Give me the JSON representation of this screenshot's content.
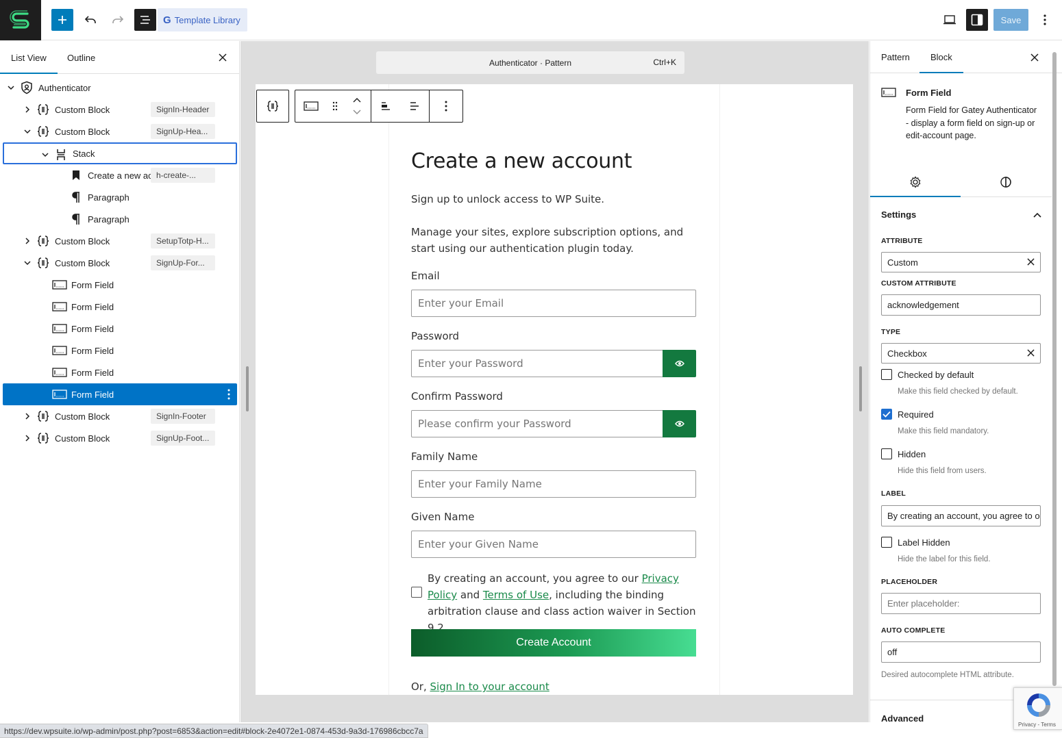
{
  "topbar": {
    "template_library_label": "Template Library",
    "save_label": "Save"
  },
  "left_panel": {
    "tabs": [
      "List View",
      "Outline"
    ],
    "tree": [
      {
        "label": "Authenticator",
        "badge": "",
        "icon": "shield-icon",
        "chevron": "down"
      },
      {
        "label": "Custom Block",
        "badge": "SignIn-Header",
        "icon": "custom-block-icon",
        "chevron": "right"
      },
      {
        "label": "Custom Block",
        "badge": "SignUp-Hea...",
        "icon": "custom-block-icon",
        "chevron": "down"
      },
      {
        "label": "Stack",
        "badge": "",
        "icon": "stack-icon",
        "chevron": "down"
      },
      {
        "label": "Create a new acc...",
        "badge": "h-create-...",
        "icon": "bookmark-icon",
        "chevron": ""
      },
      {
        "label": "Paragraph",
        "badge": "",
        "icon": "paragraph-icon",
        "chevron": ""
      },
      {
        "label": "Paragraph",
        "badge": "",
        "icon": "paragraph-icon",
        "chevron": ""
      },
      {
        "label": "Custom Block",
        "badge": "SetupTotp-H...",
        "icon": "custom-block-icon",
        "chevron": "right"
      },
      {
        "label": "Custom Block",
        "badge": "SignUp-For...",
        "icon": "custom-block-icon",
        "chevron": "down"
      },
      {
        "label": "Form Field",
        "badge": "",
        "icon": "form-field-icon",
        "chevron": ""
      },
      {
        "label": "Form Field",
        "badge": "",
        "icon": "form-field-icon",
        "chevron": ""
      },
      {
        "label": "Form Field",
        "badge": "",
        "icon": "form-field-icon",
        "chevron": ""
      },
      {
        "label": "Form Field",
        "badge": "",
        "icon": "form-field-icon",
        "chevron": ""
      },
      {
        "label": "Form Field",
        "badge": "",
        "icon": "form-field-icon",
        "chevron": ""
      },
      {
        "label": "Form Field",
        "badge": "",
        "icon": "form-field-icon",
        "chevron": "",
        "selected": true
      },
      {
        "label": "Custom Block",
        "badge": "SignIn-Footer",
        "icon": "custom-block-icon",
        "chevron": "right"
      },
      {
        "label": "Custom Block",
        "badge": "SignUp-Foot...",
        "icon": "custom-block-icon",
        "chevron": "right"
      }
    ]
  },
  "canvas": {
    "command_bar": {
      "title": "Authenticator · Pattern",
      "shortcut": "Ctrl+K"
    },
    "form": {
      "title": "Create a new account",
      "intro1": "Sign up to unlock access to WP Suite.",
      "intro2": "Manage your sites, explore subscription options, and start using our authentication plugin today.",
      "email_label": "Email",
      "email_placeholder": "Enter your Email",
      "password_label": "Password",
      "password_placeholder": "Enter your Password",
      "confirm_label": "Confirm Password",
      "confirm_placeholder": "Please confirm your Password",
      "family_label": "Family Name",
      "family_placeholder": "Enter your Family Name",
      "given_label": "Given Name",
      "given_placeholder": "Enter your Given Name",
      "consent_prefix": "By creating an account, you agree to our ",
      "consent_privacy": "Privacy Policy",
      "consent_and": " and ",
      "consent_terms": "Terms of Use",
      "consent_suffix": ", including the binding arbitration clause and class action waiver in Section 9.2.",
      "create_button": "Create Account",
      "signin_prefix": "Or, ",
      "signin_link": "Sign In to your account"
    }
  },
  "right_panel": {
    "tabs": [
      "Pattern",
      "Block"
    ],
    "block_title": "Form Field",
    "block_description": "Form Field for Gatey Authenticator - display a form field on sign-up or edit-account page.",
    "settings_title": "Settings",
    "attribute_label": "ATTRIBUTE",
    "attribute_value": "Custom",
    "custom_attribute_label": "CUSTOM ATTRIBUTE",
    "custom_attribute_value": "acknowledgement",
    "type_label": "TYPE",
    "type_value": "Checkbox",
    "checked_default_label": "Checked by default",
    "checked_default_help": "Make this field checked by default.",
    "required_label": "Required",
    "required_help": "Make this field mandatory.",
    "hidden_label": "Hidden",
    "hidden_help": "Hide this field from users.",
    "label_label": "LABEL",
    "label_value": "By creating an account, you agree to our",
    "label_hidden_label": "Label Hidden",
    "label_hidden_help": "Hide the label for this field.",
    "placeholder_label": "PLACEHOLDER",
    "placeholder_placeholder": "Enter placeholder:",
    "autocomplete_label": "AUTO COMPLETE",
    "autocomplete_value": "off",
    "autocomplete_help": "Desired autocomplete HTML attribute.",
    "advanced_label": "Advanced"
  },
  "recaptcha": {
    "text": "Privacy - Terms"
  },
  "statusbar": {
    "url": "https://dev.wpsuite.io/wp-admin/post.php?post=6853&action=edit#block-2e4072e1-0874-453d-9a3d-176986cbcc7a"
  }
}
